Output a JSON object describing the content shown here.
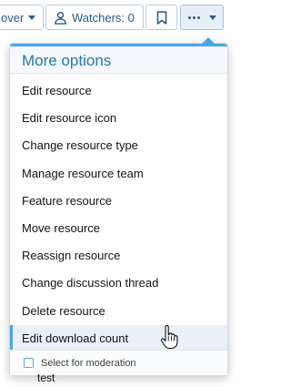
{
  "topbar": {
    "partial_label": "over",
    "watchers_label": "Watchers: 0",
    "icons": {
      "user": "user-icon",
      "bookmark": "bookmark-icon",
      "more": "ellipsis-icon"
    }
  },
  "menu": {
    "title": "More options",
    "items": [
      "Edit resource",
      "Edit resource icon",
      "Change resource type",
      "Manage resource team",
      "Feature resource",
      "Move resource",
      "Reassign resource",
      "Change discussion thread",
      "Delete resource",
      "Edit download count"
    ],
    "hovered_item": "Edit download count",
    "footer_label": "Select for moderation",
    "footer_checked": false
  },
  "background_text": "test",
  "colors": {
    "accent": "#47a7eb",
    "link": "#2a5a8c",
    "title": "#2577b1"
  }
}
